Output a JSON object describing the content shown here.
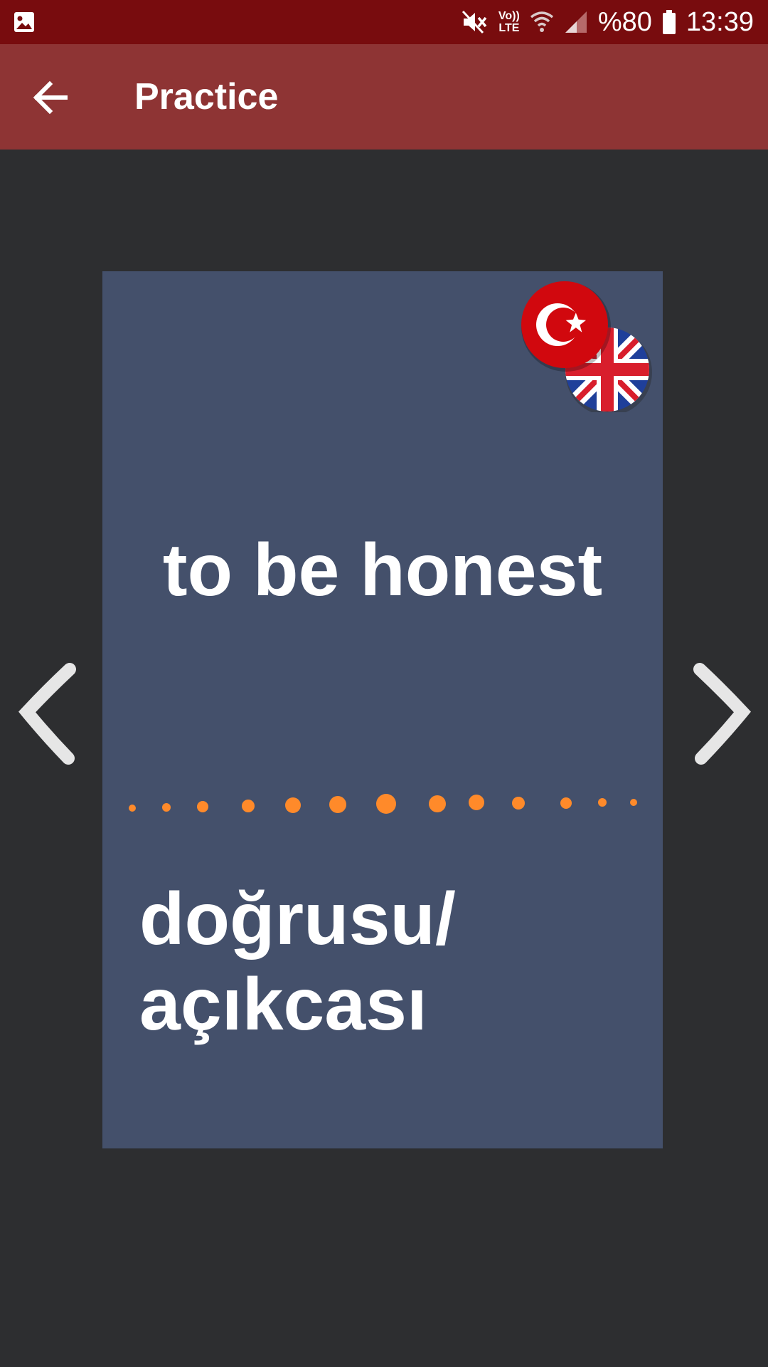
{
  "status_bar": {
    "battery_text": "%80",
    "time": "13:39",
    "network_label_top": "Vo))",
    "network_label_bottom": "LTE",
    "icons": [
      "gallery-icon",
      "mute-icon",
      "volte-icon",
      "wifi-icon",
      "signal-icon",
      "battery-icon"
    ]
  },
  "app_bar": {
    "title": "Practice",
    "back_icon": "arrow-left-icon"
  },
  "card": {
    "term": "to be honest",
    "translation": "doğrusu/ açıkcası",
    "flags": [
      "turkey-flag-icon",
      "uk-flag-icon"
    ]
  },
  "navigation": {
    "prev_icon": "chevron-left-icon",
    "next_icon": "chevron-right-icon"
  },
  "colors": {
    "status_bar": "#780c0e",
    "app_bar": "#8e3434",
    "background": "#2d2e30",
    "card": "#44506b",
    "dots": "#ff8a2a"
  }
}
